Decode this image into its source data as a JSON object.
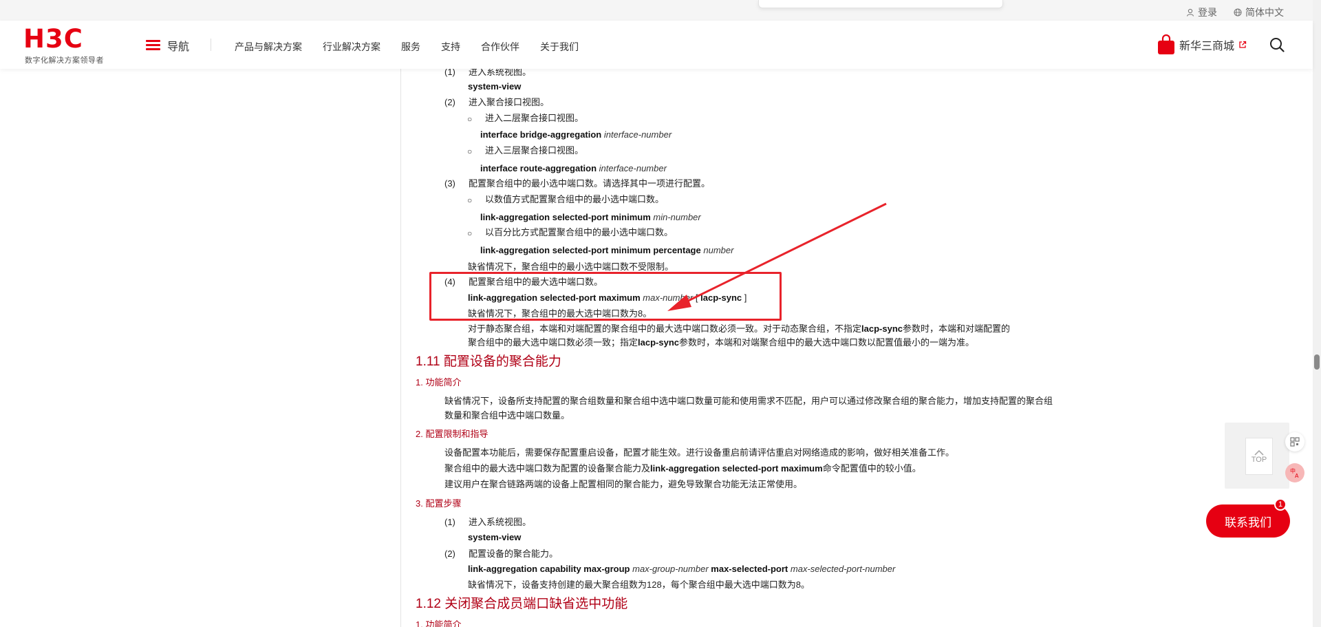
{
  "util": {
    "login": "登录",
    "language": "简体中文"
  },
  "header": {
    "logo_text": "H3C",
    "logo_tagline": "数字化解决方案领导者",
    "nav_label": "导航",
    "menu": [
      "产品与解决方案",
      "行业解决方案",
      "服务",
      "支持",
      "合作伙伴",
      "关于我们"
    ],
    "mall_label": "新华三商城"
  },
  "doc": {
    "s1_num": "(1)",
    "s1_text": "进入系统视图。",
    "s1_cmd": "system-view",
    "s2_num": "(2)",
    "s2_text": "进入聚合接口视图。",
    "s2_b1": "进入二层聚合接口视图。",
    "s2_b1_cmd": "interface bridge-aggregation",
    "s2_b1_arg": "interface-number",
    "s2_b2": "进入三层聚合接口视图。",
    "s2_b2_cmd": "interface route-aggregation",
    "s2_b2_arg": "interface-number",
    "s3_num": "(3)",
    "s3_text": "配置聚合组中的最小选中端口数。请选择其中一项进行配置。",
    "s3_b1": "以数值方式配置聚合组中的最小选中端口数。",
    "s3_b1_cmd": "link-aggregation selected-port minimum",
    "s3_b1_arg": "min-number",
    "s3_b2": "以百分比方式配置聚合组中的最小选中端口数。",
    "s3_b2_cmd": "link-aggregation selected-port minimum percentage",
    "s3_b2_arg": "number",
    "s3_default": "缺省情况下，聚合组中的最小选中端口数不受限制。",
    "s4_num": "(4)",
    "s4_text": "配置聚合组中的最大选中端口数。",
    "s4_cmd": "link-aggregation selected-port maximum",
    "s4_arg": "max-number",
    "s4_opt_open": "[",
    "s4_opt": "lacp-sync",
    "s4_opt_close": "]",
    "s4_default": "缺省情况下，聚合组中的最大选中端口数为8。",
    "s4_note1_a": "对于静态聚合组，本端和对端配置的聚合组中的最大选中端口数必须一致。对于动态聚合组，不指定",
    "s4_note1_cmd": "lacp-sync",
    "s4_note1_b": "参数时，本端和对端配置的",
    "s4_note2_a": "聚合组中的最大选中端口数必须一致；指定",
    "s4_note2_cmd": "lacp-sync",
    "s4_note2_b": "参数时，本端和对端聚合组中的最大选中端口数以配置值最小的一端为准。",
    "h_111": "1.11  配置设备的聚合能力",
    "h_111_1": "1. 功能简介",
    "p_111_1": "缺省情况下，设备所支持配置的聚合组数量和聚合组中选中端口数量可能和使用需求不匹配，用户可以通过修改聚合组的聚合能力，增加支持配置的聚合组数量和聚合组中选中端口数量。",
    "h_111_2": "2. 配置限制和指导",
    "p_111_2a": "设备配置本功能后，需要保存配置重启设备，配置才能生效。进行设备重启前请评估重启对网络造成的影响，做好相关准备工作。",
    "p_111_2b_a": "聚合组中的最大选中端口数为配置的设备聚合能力及",
    "p_111_2b_cmd": "link-aggregation selected-port maximum",
    "p_111_2b_b": "命令配置值中的较小值。",
    "p_111_2c": "建议用户在聚合链路两端的设备上配置相同的聚合能力，避免导致聚合功能无法正常使用。",
    "h_111_3": "3. 配置步骤",
    "t1_num": "(1)",
    "t1_text": "进入系统视图。",
    "t1_cmd": "system-view",
    "t2_num": "(2)",
    "t2_text": "配置设备的聚合能力。",
    "t2_cmd1": "link-aggregation capability max-group",
    "t2_arg1": "max-group-number",
    "t2_cmd2": "max-selected-port",
    "t2_arg2": "max-selected-port-number",
    "t2_default": "缺省情况下，设备支持创建的最大聚合组数为128，每个聚合组中最大选中端口数为8。",
    "h_112": "1.12  关闭聚合成员端口缺省选中功能",
    "h_112_1": "1. 功能简介"
  },
  "float": {
    "top_label": "TOP",
    "contact_label": "联系我们",
    "contact_badge": "1"
  },
  "colors": {
    "brand": "#e60012",
    "heading": "#b00016",
    "annotation": "#e8232b"
  }
}
